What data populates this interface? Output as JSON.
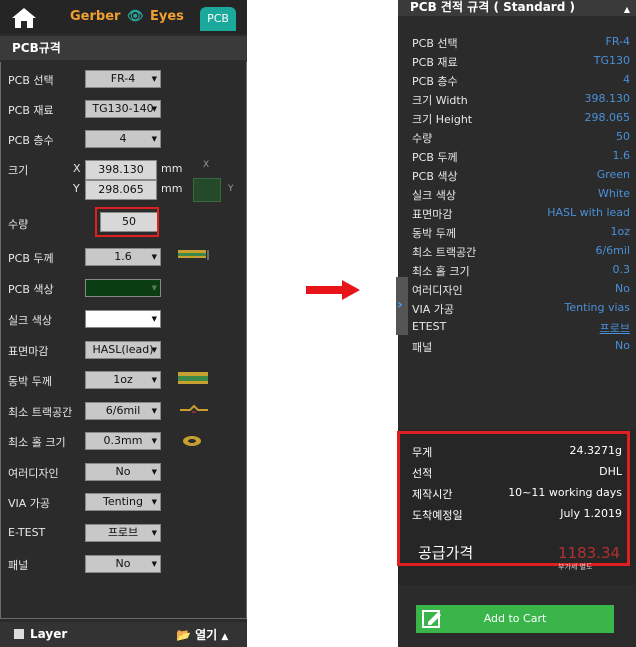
{
  "left": {
    "brand": {
      "gerber": "Gerber",
      "eyes": "Eyes"
    },
    "tab": "PCB",
    "section_title": "PCB규격",
    "rows": {
      "pcb_type": {
        "label": "PCB 선택",
        "value": "FR-4"
      },
      "pcb_material": {
        "label": "PCB 재료",
        "value": "TG130-140"
      },
      "layers": {
        "label": "PCB 층수",
        "value": "4"
      },
      "size": {
        "label": "크기",
        "x_label": "X",
        "x_value": "398.130",
        "y_label": "Y",
        "y_value": "298.065",
        "unit": "mm",
        "minor_x": "X",
        "minor_y": "Y"
      },
      "quantity": {
        "label": "수량",
        "value": "50"
      },
      "thickness": {
        "label": "PCB 두께",
        "value": "1.6"
      },
      "pcb_color": {
        "label": "PCB 색상",
        "value": ""
      },
      "silk_color": {
        "label": "실크 색상",
        "value": ""
      },
      "surface": {
        "label": "표면마감",
        "value": "HASL(lead)"
      },
      "copper": {
        "label": "동박 두께",
        "value": "1oz"
      },
      "min_trace": {
        "label": "최소 트랙공간",
        "value": "6/6mil"
      },
      "min_hole": {
        "label": "최소 홀 크기",
        "value": "0.3mm"
      },
      "multi_design": {
        "label": "여러디자인",
        "value": "No"
      },
      "via": {
        "label": "VIA 가공",
        "value": "Tenting"
      },
      "etest": {
        "label": "E-TEST",
        "value": "프로브"
      },
      "panel": {
        "label": "패널",
        "value": "No"
      }
    },
    "bottom": {
      "layer": "Layer",
      "open": "열기"
    }
  },
  "right": {
    "title": "PCB 견적 규격 ( Standard )",
    "specs": [
      {
        "k": "PCB 선택",
        "v": "FR-4"
      },
      {
        "k": "PCB 재료",
        "v": "TG130"
      },
      {
        "k": "PCB 층수",
        "v": "4"
      },
      {
        "k": "크기 Width",
        "v": "398.130"
      },
      {
        "k": "크기 Height",
        "v": "298.065"
      },
      {
        "k": "수량",
        "v": "50"
      },
      {
        "k": "PCB 두께",
        "v": "1.6"
      },
      {
        "k": "PCB 색상",
        "v": "Green"
      },
      {
        "k": "실크 색상",
        "v": "White"
      },
      {
        "k": "표면마감",
        "v": "HASL with lead"
      },
      {
        "k": "동박 두께",
        "v": "1oz"
      },
      {
        "k": "최소 트랙공간",
        "v": "6/6mil"
      },
      {
        "k": "최소 홀 크기",
        "v": "0.3"
      },
      {
        "k": "여러디자인",
        "v": "No"
      },
      {
        "k": "VIA 가공",
        "v": "Tenting vias"
      },
      {
        "k": "ETEST",
        "v": "프로브"
      },
      {
        "k": "패널",
        "v": "No"
      }
    ],
    "summary": [
      {
        "k": "무게",
        "v": "24.3271g"
      },
      {
        "k": "선적",
        "v": "DHL"
      },
      {
        "k": "제작시간",
        "v": "10~11 working days"
      },
      {
        "k": "도착예정일",
        "v": "July 1.2019"
      }
    ],
    "price_label": "공급가격",
    "price_value": "1183.34",
    "price_note": "부가세 별도",
    "add_to_cart": "Add to Cart"
  },
  "colors": {
    "pcb_color_swatch": "#0b3d12",
    "silk_color_swatch": "#ffffff",
    "accent_teal": "#1aa99a",
    "highlight_red": "#e02020",
    "link_blue": "#4a90d9",
    "cart_green": "#3ab54a"
  }
}
